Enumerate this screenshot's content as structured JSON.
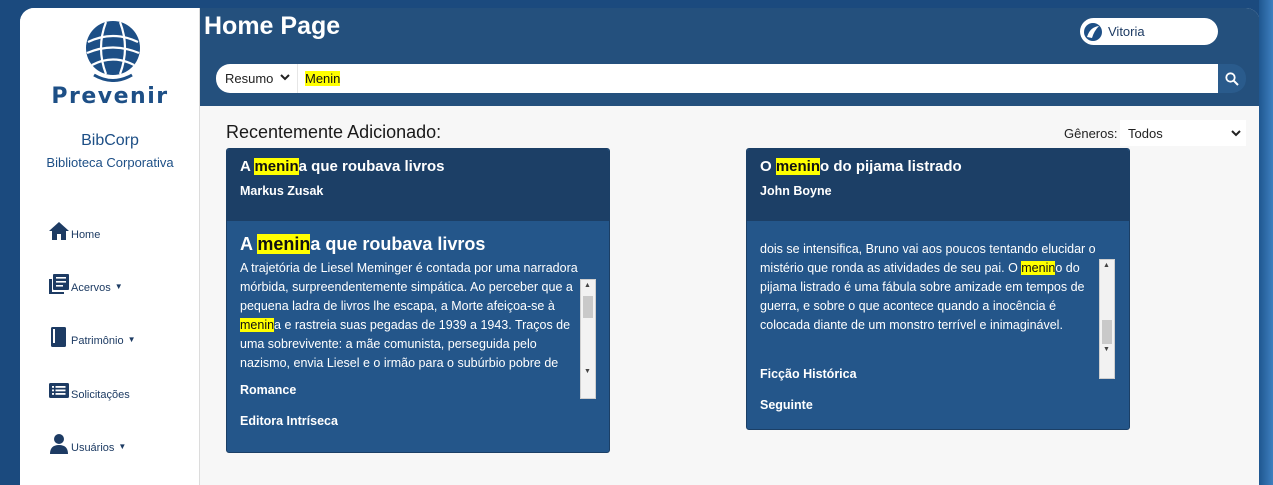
{
  "app": {
    "logo_text": "Prevenir",
    "org_name": "BibCorp",
    "org_subtitle": "Biblioteca Corporativa"
  },
  "sidebar": {
    "items": [
      {
        "label": "Home",
        "icon": "home-icon",
        "has_caret": false
      },
      {
        "label": "Acervos",
        "icon": "books-icon",
        "has_caret": true
      },
      {
        "label": "Patrimônio",
        "icon": "book-icon",
        "has_caret": true
      },
      {
        "label": "Solicitações",
        "icon": "list-icon",
        "has_caret": false
      },
      {
        "label": "Usuários",
        "icon": "user-icon",
        "has_caret": true
      }
    ]
  },
  "header": {
    "title": "Home Page",
    "user_name": "Vitoria"
  },
  "search": {
    "filter_value": "Resumo",
    "query": "Menin",
    "search_icon": "search-icon"
  },
  "content": {
    "section_title": "Recentemente Adicionado:",
    "genre_label": "Gêneros:",
    "genre_value": "Todos",
    "books": [
      {
        "title_highlight": "menin",
        "title_pre": "A ",
        "title_post": "a que roubava livros",
        "author": "Markus Zusak",
        "synopsis_title_pre": "A ",
        "synopsis_title_highlight": "menin",
        "synopsis_title_post": "a que roubava livros",
        "synopsis_pre": "A trajetória de Liesel Meminger é contada por uma narradora mórbida, surpreendentemente simpática. Ao perceber que a pequena ladra de livros lhe escapa, a Morte afeiçoa-se à ",
        "synopsis_highlight": "menin",
        "synopsis_post": "a e rastreia suas pegadas de 1939 a 1943. Traços de uma sobrevivente: a mãe comunista, perseguida pelo nazismo, envia Liesel e o irmão para o subúrbio pobre de uma cidade alemã, onde um casal se dispõe a adotá-los.",
        "genre": "Romance",
        "publisher": "Editora Intríseca"
      },
      {
        "title_highlight": "menin",
        "title_pre": "O ",
        "title_post": "o do pijama listrado",
        "author": "John Boyne",
        "synopsis_pre": "Bruno faz amizade com um garoto do outro lado da cerca, nascido no mesmo dia que ele. Conforme a amizade dos dois se intensifica, Bruno vai aos poucos tentando elucidar o mistério que ronda as atividades de seu pai. O ",
        "synopsis_highlight": "menin",
        "synopsis_post": "o do pijama listrado é uma fábula sobre amizade em tempos de guerra, e sobre o que acontece quando a inocência é colocada diante de um monstro terrível e inimaginável.",
        "genre": "Ficção Histórica",
        "publisher": "Seguinte"
      }
    ]
  },
  "colors": {
    "page_bg": "#1b4a7e",
    "topbar": "#24507d",
    "card": "#24568a",
    "card_head": "#1c3f66",
    "highlight": "#ffff00",
    "brand": "#1d4f86"
  }
}
